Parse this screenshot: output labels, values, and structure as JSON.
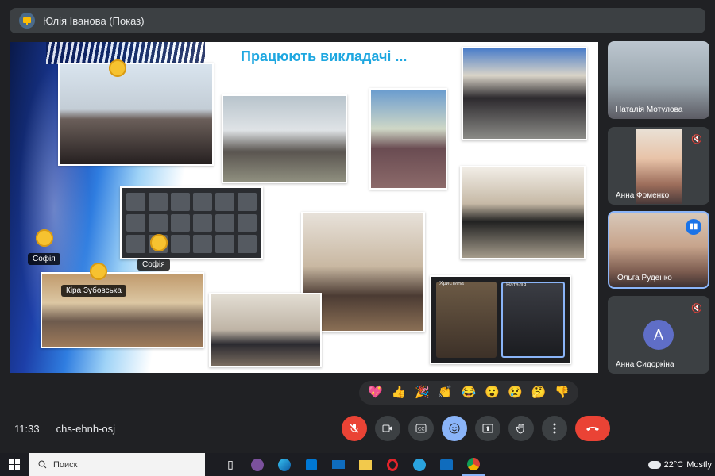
{
  "header": {
    "presenter_title": "Юлія Іванова (Показ)"
  },
  "slide": {
    "title": "Працюють викладачі ...",
    "chips": {
      "sofia_1": "Софія",
      "sofia_2": "Софія",
      "kira": "Кіра Зубовська"
    },
    "call_tiles": {
      "tile1": "Христина",
      "tile2": "Наталія"
    }
  },
  "participants": [
    {
      "name": "Наталія Мотулова",
      "muted": false
    },
    {
      "name": "Анна Фоменко",
      "muted": true
    },
    {
      "name": "Ольга Руденко",
      "muted": false,
      "speaking": true
    },
    {
      "name": "Анна Сидоркіна",
      "muted": true,
      "initial": "A",
      "avatar_color": "#5f6ec7"
    }
  ],
  "reactions": [
    "💖",
    "👍",
    "🎉",
    "👏",
    "😂",
    "😮",
    "😢",
    "🤔",
    "👎"
  ],
  "meeting": {
    "time": "11:33",
    "code": "chs-ehnh-osj"
  },
  "controls": [
    "mic-off",
    "camera",
    "captions",
    "emoji",
    "present",
    "raise-hand",
    "more",
    "leave"
  ],
  "taskbar": {
    "search_placeholder": "Поиск",
    "weather_temp": "22°C",
    "weather_text": "Mostly"
  },
  "colors": {
    "accent": "#8ab4f8",
    "danger": "#ea4335",
    "title_blue": "#1ea7e0"
  }
}
